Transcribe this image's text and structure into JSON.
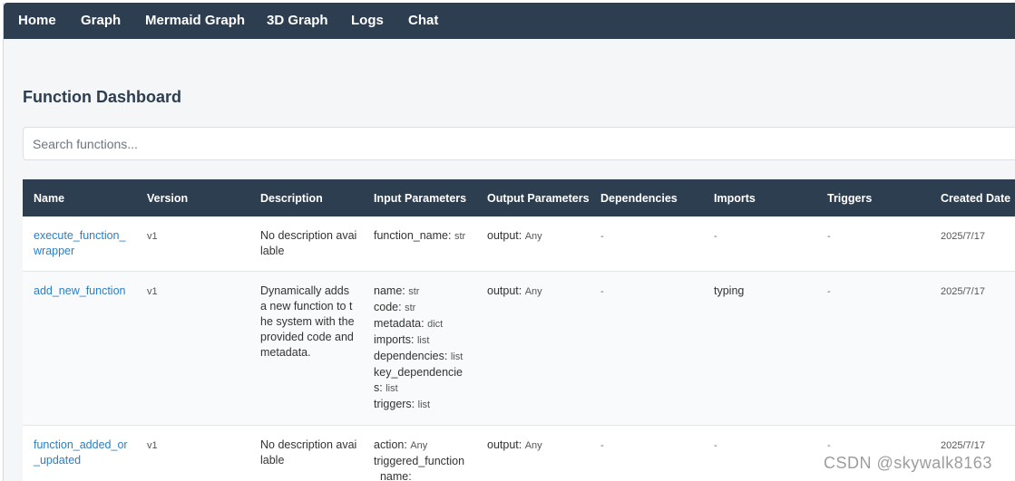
{
  "nav": {
    "items": [
      "Home",
      "Graph",
      "Mermaid Graph",
      "3D Graph",
      "Logs",
      "Chat"
    ]
  },
  "page": {
    "title": "Function Dashboard"
  },
  "search": {
    "placeholder": "Search functions...",
    "value": ""
  },
  "table": {
    "headers": [
      "Name",
      "Version",
      "Description",
      "Input Parameters",
      "Output Parameters",
      "Dependencies",
      "Imports",
      "Triggers",
      "Created Date"
    ],
    "rows": [
      {
        "name": "execute_function_wrapper",
        "version": "v1",
        "description": "No description available",
        "inputs": [
          {
            "name": "function_name:",
            "type": "str"
          }
        ],
        "output_label": "output:",
        "output_type": "Any",
        "dependencies": "-",
        "imports": "-",
        "triggers": "-",
        "created": "2025/7/17"
      },
      {
        "name": "add_new_function",
        "version": "v1",
        "description": "Dynamically adds a new function to the system with the provided code and metadata.",
        "inputs": [
          {
            "name": "name:",
            "type": "str"
          },
          {
            "name": "code:",
            "type": "str"
          },
          {
            "name": "metadata:",
            "type": "dict"
          },
          {
            "name": "imports:",
            "type": "list"
          },
          {
            "name": "dependencies:",
            "type": "list"
          },
          {
            "name": "key_dependencies:",
            "type": "list"
          },
          {
            "name": "triggers:",
            "type": "list"
          }
        ],
        "output_label": "output:",
        "output_type": "Any",
        "dependencies": "-",
        "imports": "typing",
        "triggers": "-",
        "created": "2025/7/17"
      },
      {
        "name": "function_added_or_updated",
        "version": "v1",
        "description": "No description available",
        "inputs": [
          {
            "name": "action:",
            "type": "Any"
          },
          {
            "name": "triggered_function_name:",
            "type": ""
          }
        ],
        "output_label": "output:",
        "output_type": "Any",
        "dependencies": "-",
        "imports": "-",
        "triggers": "-",
        "created": "2025/7/17"
      }
    ]
  },
  "watermark": "CSDN @skywalk8163"
}
